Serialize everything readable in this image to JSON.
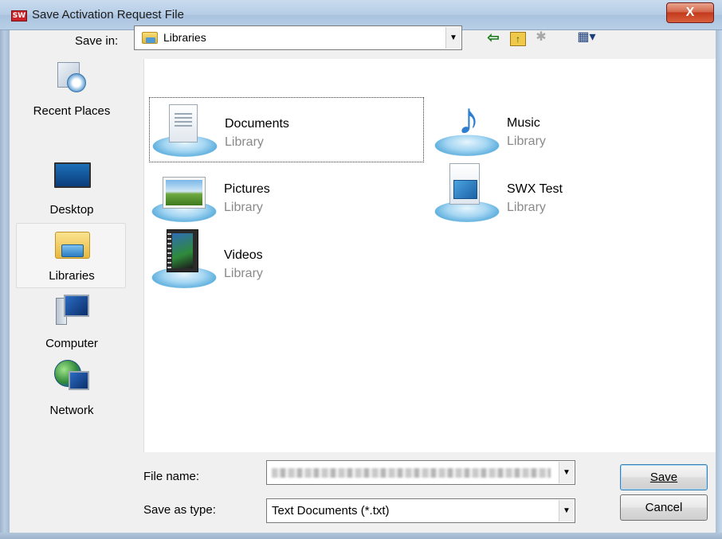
{
  "window": {
    "title": "Save Activation Request File",
    "app_icon_text": "SW",
    "close_glyph": "X"
  },
  "toolbar": {
    "save_in_label": "Save in:",
    "save_in_value": "Libraries",
    "icons": [
      "back-arrow-icon",
      "up-folder-icon",
      "new-folder-icon",
      "view-menu-icon"
    ]
  },
  "places": [
    {
      "label": "Recent Places",
      "icon": "recent-places-icon",
      "selected": false
    },
    {
      "label": "Desktop",
      "icon": "desktop-icon",
      "selected": false
    },
    {
      "label": "Libraries",
      "icon": "libraries-icon",
      "selected": true
    },
    {
      "label": "Computer",
      "icon": "computer-icon",
      "selected": false
    },
    {
      "label": "Network",
      "icon": "network-icon",
      "selected": false
    }
  ],
  "items": [
    {
      "name": "Documents",
      "type": "Library",
      "icon": "documents-library-icon"
    },
    {
      "name": "Music",
      "type": "Library",
      "icon": "music-library-icon"
    },
    {
      "name": "Pictures",
      "type": "Library",
      "icon": "pictures-library-icon"
    },
    {
      "name": "SWX Test",
      "type": "Library",
      "icon": "swx-test-library-icon"
    },
    {
      "name": "Videos",
      "type": "Library",
      "icon": "videos-library-icon"
    }
  ],
  "form": {
    "file_name_label": "File name:",
    "file_name_value": "",
    "save_as_type_label": "Save as type:",
    "save_as_type_value": "Text Documents (*.txt)"
  },
  "buttons": {
    "save": "Save",
    "cancel": "Cancel"
  }
}
